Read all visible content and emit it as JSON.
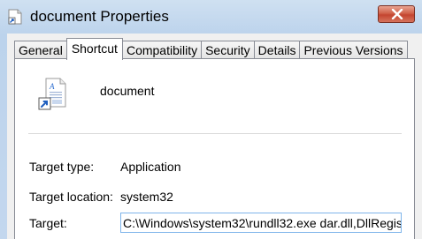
{
  "window": {
    "title": "document Properties"
  },
  "tabs": [
    {
      "label": "General"
    },
    {
      "label": "Shortcut"
    },
    {
      "label": "Compatibility"
    },
    {
      "label": "Security"
    },
    {
      "label": "Details"
    },
    {
      "label": "Previous Versions"
    }
  ],
  "active_tab": "Shortcut",
  "shortcut": {
    "name": "document",
    "target_type_label": "Target type:",
    "target_type_value": "Application",
    "target_location_label": "Target location:",
    "target_location_value": "system32",
    "target_label": "Target:",
    "target_value": "C:\\Windows\\system32\\rundll32.exe dar.dll,DllRegis"
  },
  "colors": {
    "close_button": "#c44530",
    "input_border": "#7eb4ea",
    "titlebar": "#bcd3ec"
  },
  "icons": [
    "shortcut-file-icon",
    "document-shortcut-icon",
    "close-icon"
  ]
}
